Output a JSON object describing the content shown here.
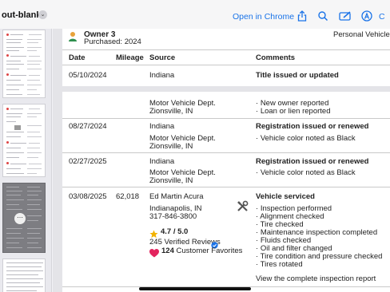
{
  "toolbar": {
    "doc_title": "out-blank",
    "open_in_chrome": "Open in Chrome",
    "cut_label": "C"
  },
  "owner": {
    "name": "Owner 3",
    "purchased": "Purchased: 2024",
    "type": "Personal Vehicle"
  },
  "table": {
    "headers": {
      "date": "Date",
      "mileage": "Mileage",
      "source": "Source",
      "comments": "Comments"
    }
  },
  "records": [
    {
      "date": "05/10/2024",
      "source": "Indiana",
      "comment": "Title issued or updated"
    },
    {
      "source_lines": [
        "Motor Vehicle Dept.",
        "Zionsville, IN"
      ],
      "comments": [
        "New owner reported",
        "Loan or lien reported"
      ]
    },
    {
      "date": "08/27/2024",
      "source": "Indiana",
      "source_lines": [
        "Motor Vehicle Dept.",
        "Zionsville, IN"
      ],
      "comment_title": "Registration issued or renewed",
      "comments": [
        "Vehicle color noted as Black"
      ]
    },
    {
      "date": "02/27/2025",
      "source": "Indiana",
      "source_lines": [
        "Motor Vehicle Dept.",
        "Zionsville, IN"
      ],
      "comment_title": "Registration issued or renewed",
      "comments": [
        "Vehicle color noted as Black"
      ]
    },
    {
      "date": "03/08/2025",
      "mileage": "62,018",
      "source": "Ed Martin Acura",
      "address": [
        "Indianapolis, IN",
        "317-846-3800"
      ],
      "rating": "4.7 / 5.0",
      "reviews": "245 Verified Reviews",
      "favorites_count": "124",
      "favorites_label": "Customer Favorites",
      "comment_title": "Vehicle serviced",
      "comments": [
        "Inspection performed",
        "Alignment checked",
        "Tire checked",
        "Maintenance inspection completed",
        "Fluids checked",
        "Oil and filter changed",
        "Tire condition and pressure checked",
        "Tires rotated"
      ],
      "report_link": "View the complete inspection report"
    }
  ],
  "colors": {
    "link": "#1a73e8",
    "heart": "#e3245e",
    "star": "#f2b200",
    "verified": "#1a73e8"
  },
  "icons": [
    "chevron-down-icon",
    "share-icon",
    "search-icon",
    "markup-icon",
    "accessibility-icon",
    "person-icon",
    "tools-icon",
    "star-icon",
    "verified-icon",
    "heart-icon"
  ]
}
